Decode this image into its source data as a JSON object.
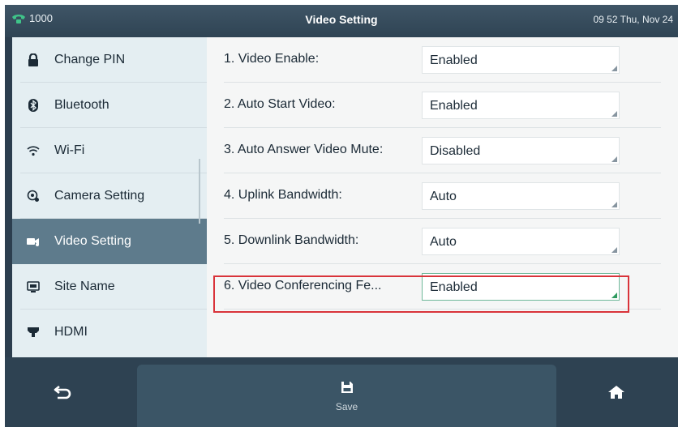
{
  "status_bar": {
    "line_label": "1000",
    "title": "Video Setting",
    "datetime": "09 52 Thu, Nov 24"
  },
  "sidebar": {
    "items": [
      {
        "label": "Change PIN",
        "icon": "lock-icon"
      },
      {
        "label": "Bluetooth",
        "icon": "bluetooth-icon"
      },
      {
        "label": "Wi-Fi",
        "icon": "wifi-icon"
      },
      {
        "label": "Camera Setting",
        "icon": "camera-icon"
      },
      {
        "label": "Video Setting",
        "icon": "video-icon",
        "active": true
      },
      {
        "label": "Site Name",
        "icon": "monitor-icon"
      },
      {
        "label": "HDMI",
        "icon": "hdmi-icon"
      }
    ]
  },
  "settings": [
    {
      "label": "1. Video Enable:",
      "value": "Enabled"
    },
    {
      "label": "2. Auto Start Video:",
      "value": "Enabled"
    },
    {
      "label": "3. Auto Answer Video Mute:",
      "value": "Disabled"
    },
    {
      "label": "4. Uplink Bandwidth:",
      "value": "Auto"
    },
    {
      "label": "5. Downlink Bandwidth:",
      "value": "Auto"
    },
    {
      "label": "6. Video Conferencing Fe...",
      "value": "Enabled",
      "focused": true
    }
  ],
  "bottom_bar": {
    "back_icon": "back-arrow-icon",
    "save_label": "Save",
    "save_icon": "floppy-disk-icon",
    "home_icon": "home-icon"
  },
  "colors": {
    "header_bg": "#3f5566",
    "sidebar_bg": "#e4eef2",
    "sidebar_active_bg": "#5e7b8c",
    "highlight_border": "#d9333a",
    "line_status_green": "#3fc489"
  }
}
